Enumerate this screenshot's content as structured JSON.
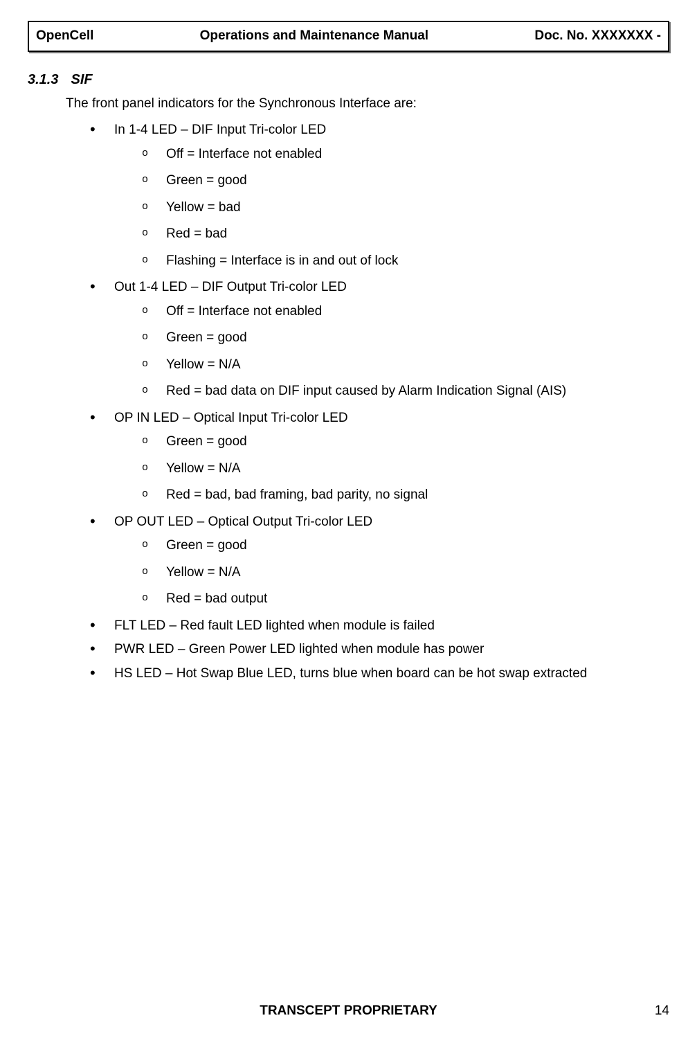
{
  "header": {
    "left": "OpenCell",
    "center": "Operations and Maintenance Manual",
    "right": "Doc. No.  XXXXXXX -"
  },
  "section": {
    "number": "3.1.3",
    "title": "SIF",
    "intro": "The front panel indicators for the Synchronous Interface are:"
  },
  "bullets": [
    {
      "text": "In 1-4 LED – DIF Input Tri-color LED",
      "sub": [
        "Off = Interface not enabled",
        "Green = good",
        "Yellow = bad",
        "Red = bad",
        "Flashing = Interface is in and out of lock"
      ]
    },
    {
      "text": "Out 1-4 LED – DIF Output Tri-color LED",
      "sub": [
        "Off = Interface not enabled",
        "Green = good",
        "Yellow = N/A",
        "Red = bad data on DIF input caused by Alarm Indication Signal (AIS)"
      ]
    },
    {
      "text": "OP IN LED – Optical Input Tri-color LED",
      "sub": [
        "Green = good",
        "Yellow = N/A",
        "Red = bad, bad framing, bad parity, no signal"
      ]
    },
    {
      "text": "OP OUT LED – Optical Output Tri-color LED",
      "sub": [
        "Green = good",
        "Yellow = N/A",
        "Red = bad output"
      ]
    },
    {
      "text": "FLT LED – Red fault LED lighted when module is failed",
      "sub": []
    },
    {
      "text": "PWR LED – Green Power LED lighted when module has power",
      "sub": []
    },
    {
      "text": "HS LED – Hot Swap Blue LED, turns blue when board can be hot swap extracted",
      "sub": []
    }
  ],
  "footer": {
    "center": "TRANSCEPT PROPRIETARY",
    "page": "14"
  }
}
